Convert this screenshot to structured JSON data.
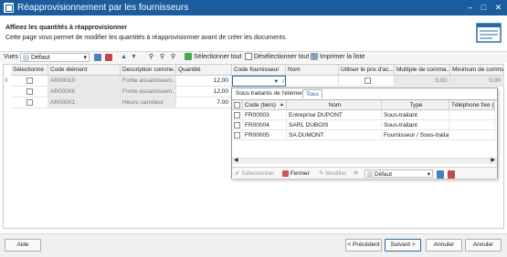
{
  "window": {
    "title": "Réapprovisionnement par les fournisseurs"
  },
  "header": {
    "title": "Affinez les quantités à réapprovisionner",
    "description": "Cette page vous permet de modifier les quantités à réapprovisionner avant de créer les documents."
  },
  "toolbar": {
    "views_label": "Vues",
    "view_value": "Défaut",
    "select_all": "Sélectionner tout",
    "deselect_all": "Désélectionner tout",
    "print_list": "Imprimer la liste"
  },
  "grid": {
    "columns": [
      "Sélectionné",
      "Code élément",
      "Description comme...",
      "Quantité",
      "Code fournisseur",
      "Nom",
      "Utiliser le prix d'ac...",
      "Multiple de comma...",
      "Minimum de comma..."
    ],
    "rows": [
      {
        "code": "AR00010",
        "description": "Fonte assainissem...",
        "quantity": "12,00",
        "multiple": "0,00",
        "minimum": "0,00"
      },
      {
        "code": "AR00006",
        "description": "Fonte assainissem...",
        "quantity": "12,00"
      },
      {
        "code": "AR00001",
        "description": "Heure carreleur",
        "quantity": "7,00"
      }
    ]
  },
  "popup": {
    "tabs": [
      "Sous traitants de l'élément",
      "Tous"
    ],
    "columns": [
      "Code (tiers)",
      "Nom",
      "Type",
      "Téléphone fixe (fon"
    ],
    "rows": [
      {
        "code": "FR00003",
        "name": "Entreprise DUPONT",
        "type": "Sous-traitant",
        "phone": ""
      },
      {
        "code": "FR00004",
        "name": "SARL DUBOIS",
        "type": "Sous-traitant",
        "phone": ""
      },
      {
        "code": "FR00005",
        "name": "SA DUMONT",
        "type": "Fournisseur / Sous-traitant",
        "phone": ""
      }
    ],
    "footer": {
      "select": "Sélectionner",
      "close": "Fermer",
      "modify": "Modifier",
      "view": "Défaut"
    }
  },
  "footer": {
    "help": "Aide",
    "previous": "< Précédent",
    "next": "Suivant >",
    "cancel": "Annuler",
    "cancel2": "Annuler"
  },
  "colors": {
    "titlebar": "#1a5c9e",
    "accent": "#1a5c9e"
  }
}
